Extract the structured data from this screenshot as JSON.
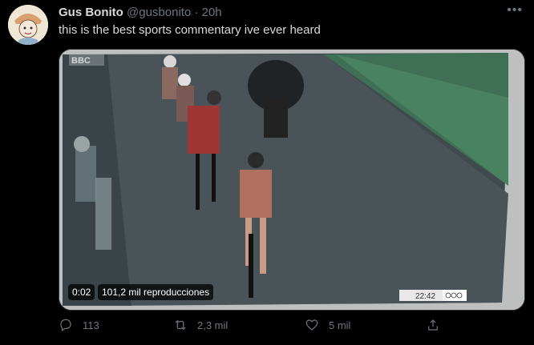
{
  "tweet": {
    "display_name": "Gus Bonito",
    "handle": "@gusbonito",
    "separator": "·",
    "time": "20h",
    "more_icon": "more-icon",
    "text": "this is the best sports commentary ive ever heard"
  },
  "media": {
    "duration": "0:02",
    "views": "101,2 mil reproducciones",
    "broadcaster": "BBC",
    "clock": "22:42"
  },
  "actions": {
    "reply_count": "113",
    "retweet_count": "2,3 mil",
    "like_count": "5 mil"
  },
  "colors": {
    "background": "#000000",
    "text": "#d9d9d9",
    "muted": "#6e767d",
    "border": "#2f3336"
  }
}
